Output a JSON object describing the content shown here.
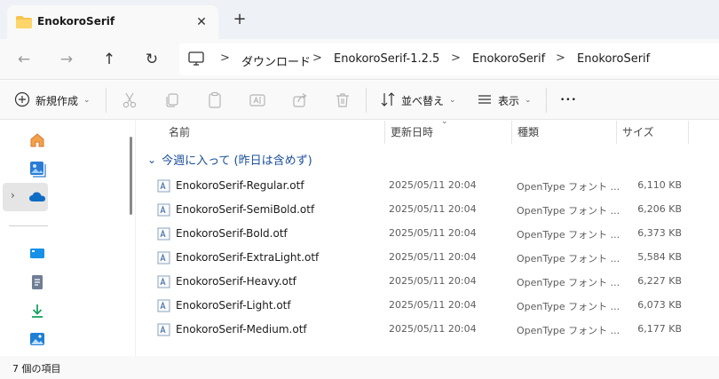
{
  "tab": {
    "title": "EnokoroSerif",
    "close": "✕",
    "new": "+"
  },
  "nav": {
    "back": "←",
    "forward": "→",
    "up": "↑",
    "refresh": "↻"
  },
  "breadcrumb": {
    "separator": ">",
    "items": [
      "ダウンロード",
      "EnokoroSerif-1.2.5",
      "EnokoroSerif",
      "EnokoroSerif"
    ]
  },
  "toolbar": {
    "new_label": "新規作成",
    "sort_label": "並べ替え",
    "view_label": "表示",
    "more": "•••"
  },
  "columns": {
    "name": "名前",
    "date": "更新日時",
    "type": "種類",
    "size": "サイズ"
  },
  "group_label": "今週に入って (昨日は含めず)",
  "files": [
    {
      "name": "EnokoroSerif-Regular.otf",
      "date": "2025/05/11 20:04",
      "type": "OpenType フォント ...",
      "size": "6,110 KB"
    },
    {
      "name": "EnokoroSerif-SemiBold.otf",
      "date": "2025/05/11 20:04",
      "type": "OpenType フォント ...",
      "size": "6,206 KB"
    },
    {
      "name": "EnokoroSerif-Bold.otf",
      "date": "2025/05/11 20:04",
      "type": "OpenType フォント ...",
      "size": "6,373 KB"
    },
    {
      "name": "EnokoroSerif-ExtraLight.otf",
      "date": "2025/05/11 20:04",
      "type": "OpenType フォント ...",
      "size": "5,584 KB"
    },
    {
      "name": "EnokoroSerif-Heavy.otf",
      "date": "2025/05/11 20:04",
      "type": "OpenType フォント ...",
      "size": "6,227 KB"
    },
    {
      "name": "EnokoroSerif-Light.otf",
      "date": "2025/05/11 20:04",
      "type": "OpenType フォント ...",
      "size": "6,073 KB"
    },
    {
      "name": "EnokoroSerif-Medium.otf",
      "date": "2025/05/11 20:04",
      "type": "OpenType フォント ...",
      "size": "6,177 KB"
    }
  ],
  "status": {
    "item_count": "7 個の項目"
  },
  "icons": {
    "sidebar": [
      "home-icon",
      "gallery-icon",
      "onedrive-icon",
      "desktop-icon",
      "documents-icon",
      "downloads-icon",
      "pictures-icon"
    ]
  },
  "colors": {
    "accent": "#0067c0",
    "group_text": "#1b4f9c",
    "folder": "#f8c44f"
  }
}
